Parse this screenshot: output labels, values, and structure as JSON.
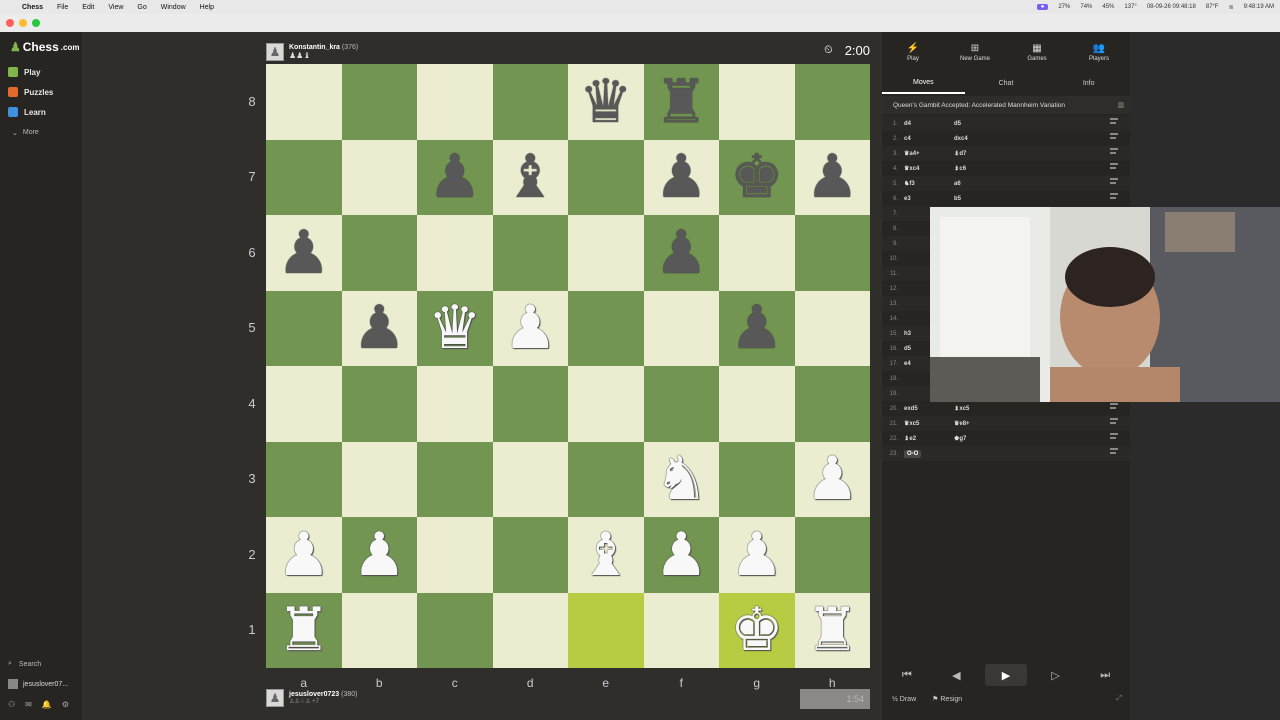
{
  "menubar": {
    "app": "Chess",
    "items": [
      "File",
      "Edit",
      "View",
      "Go",
      "Window",
      "Help"
    ],
    "stats": [
      "27%",
      "74%",
      "45%",
      "137°",
      "08-09-26 09:48:18",
      "87°F"
    ],
    "clock": "9:48:19 AM"
  },
  "sidebar": {
    "brand": "Chess",
    "brand_suffix": ".com",
    "nav": [
      {
        "label": "Play",
        "color": "#81b64c"
      },
      {
        "label": "Puzzles",
        "color": "#e26b2b"
      },
      {
        "label": "Learn",
        "color": "#3d8fe0"
      }
    ],
    "more": "More",
    "search": "Search",
    "username": "jesuslover07..."
  },
  "top_player": {
    "name": "Konstantin_kra",
    "rating": "(376)",
    "captured": "♟♟♝",
    "clock": "2:00"
  },
  "bottom_player": {
    "name": "jesuslover0723",
    "rating": "(380)",
    "captured": "♙♙♘♙ +7",
    "clock": "1:54"
  },
  "board": {
    "colors": {
      "light": "#ebecd0",
      "dark": "#739552",
      "highlight_light": "#f5f682",
      "highlight_dark": "#b9ca43"
    },
    "ranks": [
      "8",
      "7",
      "6",
      "5",
      "4",
      "3",
      "2",
      "1"
    ],
    "files": [
      "a",
      "b",
      "c",
      "d",
      "e",
      "f",
      "g",
      "h"
    ],
    "highlights": [
      "e1",
      "g1"
    ],
    "pieces": [
      {
        "sq": "e8",
        "glyph": "♛",
        "color": "b"
      },
      {
        "sq": "f8",
        "glyph": "♜",
        "color": "b"
      },
      {
        "sq": "c7",
        "glyph": "♟",
        "color": "b"
      },
      {
        "sq": "d7",
        "glyph": "♝",
        "color": "b"
      },
      {
        "sq": "f7",
        "glyph": "♟",
        "color": "b"
      },
      {
        "sq": "g7",
        "glyph": "♚",
        "color": "b"
      },
      {
        "sq": "h7",
        "glyph": "♟",
        "color": "b"
      },
      {
        "sq": "a6",
        "glyph": "♟",
        "color": "b"
      },
      {
        "sq": "f6",
        "glyph": "♟",
        "color": "b"
      },
      {
        "sq": "b5",
        "glyph": "♟",
        "color": "b"
      },
      {
        "sq": "c5",
        "glyph": "♛",
        "color": "w"
      },
      {
        "sq": "d5",
        "glyph": "♟",
        "color": "w"
      },
      {
        "sq": "g5",
        "glyph": "♟",
        "color": "b"
      },
      {
        "sq": "f3",
        "glyph": "♞",
        "color": "w"
      },
      {
        "sq": "h3",
        "glyph": "♟",
        "color": "w"
      },
      {
        "sq": "a2",
        "glyph": "♟",
        "color": "w"
      },
      {
        "sq": "b2",
        "glyph": "♟",
        "color": "w"
      },
      {
        "sq": "e2",
        "glyph": "♝",
        "color": "w"
      },
      {
        "sq": "f2",
        "glyph": "♟",
        "color": "w"
      },
      {
        "sq": "g2",
        "glyph": "♟",
        "color": "w"
      },
      {
        "sq": "a1",
        "glyph": "♜",
        "color": "w"
      },
      {
        "sq": "g1",
        "glyph": "♚",
        "color": "w"
      },
      {
        "sq": "h1",
        "glyph": "♜",
        "color": "w"
      }
    ]
  },
  "panel": {
    "topnav": [
      {
        "label": "Play",
        "icon": "⚡"
      },
      {
        "label": "New Game",
        "icon": "⊞"
      },
      {
        "label": "Games",
        "icon": "▦"
      },
      {
        "label": "Players",
        "icon": "👥"
      }
    ],
    "tabs": [
      "Moves",
      "Chat",
      "Info"
    ],
    "opening": "Queen's Gambit Accepted: Accelerated Mannheim Variation",
    "moves": [
      {
        "n": "1.",
        "w": "d4",
        "b": "d5"
      },
      {
        "n": "2.",
        "w": "c4",
        "b": "dxc4"
      },
      {
        "n": "3.",
        "w": "♛a4+",
        "b": "♝d7"
      },
      {
        "n": "4.",
        "w": "♛xc4",
        "b": "♝c6"
      },
      {
        "n": "5.",
        "w": "♞f3",
        "b": "a6"
      },
      {
        "n": "6.",
        "w": "e3",
        "b": "b5"
      },
      {
        "n": "7.",
        "w": "",
        "b": ""
      },
      {
        "n": "8.",
        "w": "",
        "b": ""
      },
      {
        "n": "9.",
        "w": "",
        "b": ""
      },
      {
        "n": "10.",
        "w": "",
        "b": ""
      },
      {
        "n": "11.",
        "w": "",
        "b": ""
      },
      {
        "n": "12.",
        "w": "",
        "b": ""
      },
      {
        "n": "13.",
        "w": "",
        "b": ""
      },
      {
        "n": "14.",
        "w": "",
        "b": ""
      },
      {
        "n": "15.",
        "w": "h3",
        "b": ""
      },
      {
        "n": "16.",
        "w": "d5",
        "b": ""
      },
      {
        "n": "17.",
        "w": "e4",
        "b": ""
      },
      {
        "n": "18.",
        "w": "",
        "b": ""
      },
      {
        "n": "19.",
        "w": "",
        "b": ""
      },
      {
        "n": "20.",
        "w": "exd5",
        "b": "♝xc5"
      },
      {
        "n": "21.",
        "w": "♛xc5",
        "b": "♛e8+"
      },
      {
        "n": "22.",
        "w": "♝e2",
        "b": "♚g7"
      },
      {
        "n": "23.",
        "w": "O-O",
        "b": ""
      }
    ],
    "controls": [
      "⏮",
      "◀",
      "▶",
      "▷",
      "⏭"
    ],
    "draw": "Draw",
    "resign": "Resign"
  }
}
